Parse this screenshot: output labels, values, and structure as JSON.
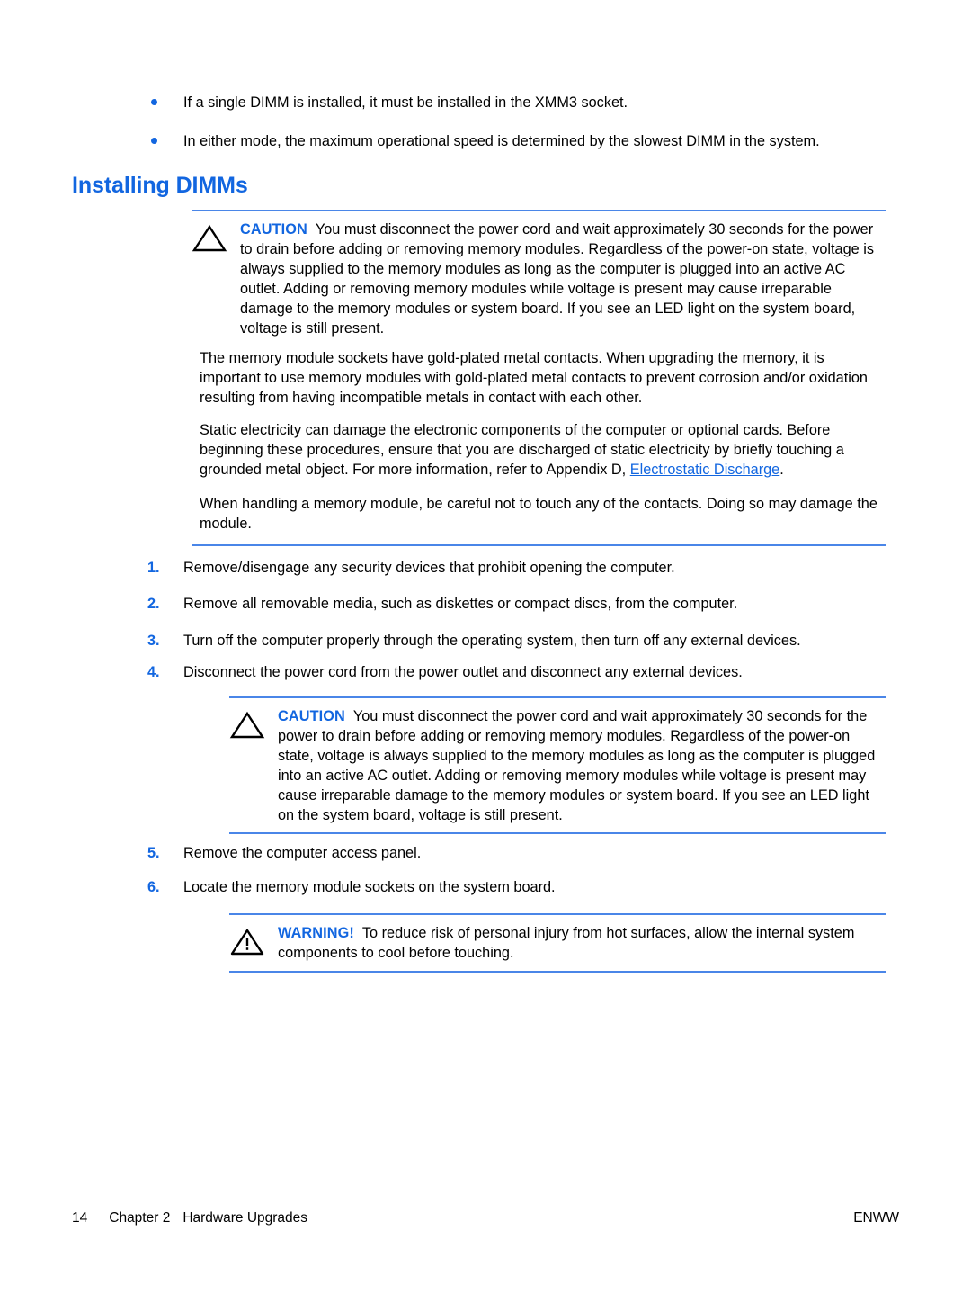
{
  "bullets": [
    {
      "text": "If a single DIMM is installed, it must be installed in the XMM3 socket."
    },
    {
      "text": "In either mode, the maximum operational speed is determined by the slowest DIMM in the system."
    }
  ],
  "heading": "Installing DIMMs",
  "caution_1": {
    "label": "CAUTION",
    "text": "You must disconnect the power cord and wait approximately 30 seconds for the power to drain before adding or removing memory modules. Regardless of the power-on state, voltage is always supplied to the memory modules as long as the computer is plugged into an active AC outlet. Adding or removing memory modules while voltage is present may cause irreparable damage to the memory modules or system board. If you see an LED light on the system board, voltage is still present.",
    "icon": "caution-triangle-icon"
  },
  "paragraphs": {
    "gold_contacts": "The memory module sockets have gold-plated metal contacts. When upgrading the memory, it is important to use memory modules with gold-plated metal contacts to prevent corrosion and/or oxidation resulting from having incompatible metals in contact with each other.",
    "static_part1": "Static electricity can damage the electronic components of the computer or optional cards. Before beginning these procedures, ensure that you are discharged of static electricity by briefly touching a grounded metal object. For more information, refer to Appendix D, ",
    "static_link": "Electrostatic Discharge",
    "static_part2": ".",
    "handling": "When handling a memory module, be careful not to touch any of the contacts. Doing so may damage the module."
  },
  "steps": [
    {
      "num": "1.",
      "text": "Remove/disengage any security devices that prohibit opening the computer."
    },
    {
      "num": "2.",
      "text": "Remove all removable media, such as diskettes or compact discs, from the computer."
    },
    {
      "num": "3.",
      "text": "Turn off the computer properly through the operating system, then turn off any external devices."
    },
    {
      "num": "4.",
      "text": "Disconnect the power cord from the power outlet and disconnect any external devices."
    },
    {
      "num": "5.",
      "text": "Remove the computer access panel."
    },
    {
      "num": "6.",
      "text": "Locate the memory module sockets on the system board."
    }
  ],
  "caution_2": {
    "label": "CAUTION",
    "text": "You must disconnect the power cord and wait approximately 30 seconds for the power to drain before adding or removing memory modules. Regardless of the power-on state, voltage is always supplied to the memory modules as long as the computer is plugged into an active AC outlet. Adding or removing memory modules while voltage is present may cause irreparable damage to the memory modules or system board. If you see an LED light on the system board, voltage is still present.",
    "icon": "caution-triangle-icon"
  },
  "warning_1": {
    "label": "WARNING!",
    "text": "To reduce risk of personal injury from hot surfaces, allow the internal system components to cool before touching.",
    "icon": "warning-triangle-exclamation-icon"
  },
  "footer": {
    "page_number": "14",
    "chapter": "Chapter 2",
    "chapter_title": "Hardware Upgrades",
    "locale": "ENWW"
  },
  "colors": {
    "accent_blue": "#1266e0",
    "rule_blue": "#4a86e8",
    "text_black": "#000000"
  }
}
